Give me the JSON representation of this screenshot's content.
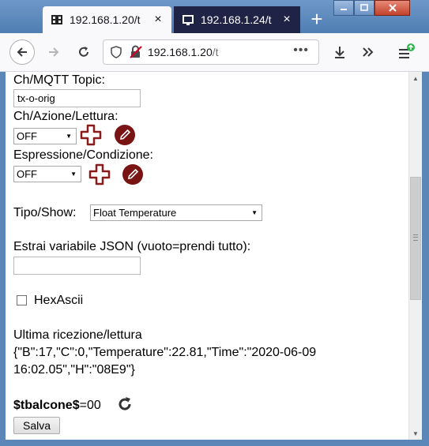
{
  "tabs": [
    {
      "title": "192.168.1.20/t",
      "close": "×"
    },
    {
      "title": "192.168.1.24/t",
      "close": "×"
    }
  ],
  "new_tab": "+",
  "urlbar": {
    "host": "192.168.1.20",
    "path": "/t",
    "more": "•••"
  },
  "form": {
    "mqtt_topic_label": "Ch/MQTT Topic:",
    "mqtt_topic_value": "tx-o-orig",
    "azione_label": "Ch/Azione/Lettura:",
    "azione_select": "OFF",
    "espressione_label": "Espressione/Condizione:",
    "espressione_select": "OFF",
    "tipo_label": "Tipo/Show:",
    "tipo_select": "Float Temperature",
    "json_label": "Estrai variabile JSON (vuoto=prendi tutto):",
    "json_value": "",
    "hexascii_label": "HexAscii",
    "hexascii_checked": false,
    "ultima_label": "Ultima ricezione/lettura",
    "ultima_line1": "{\"B\":17,\"C\":0,\"Temperature\":22.81,\"Time\":\"2020-06-09",
    "ultima_line2": "16:02.05\",\"H\":\"08E9\"}",
    "var_name": "$tbalcone$",
    "var_value": "=00",
    "save_label": "Salva"
  },
  "colors": {
    "accent_red": "#8b1a1a",
    "tab_inactive": "#1f2447",
    "titlebar": "#5b87b8"
  }
}
